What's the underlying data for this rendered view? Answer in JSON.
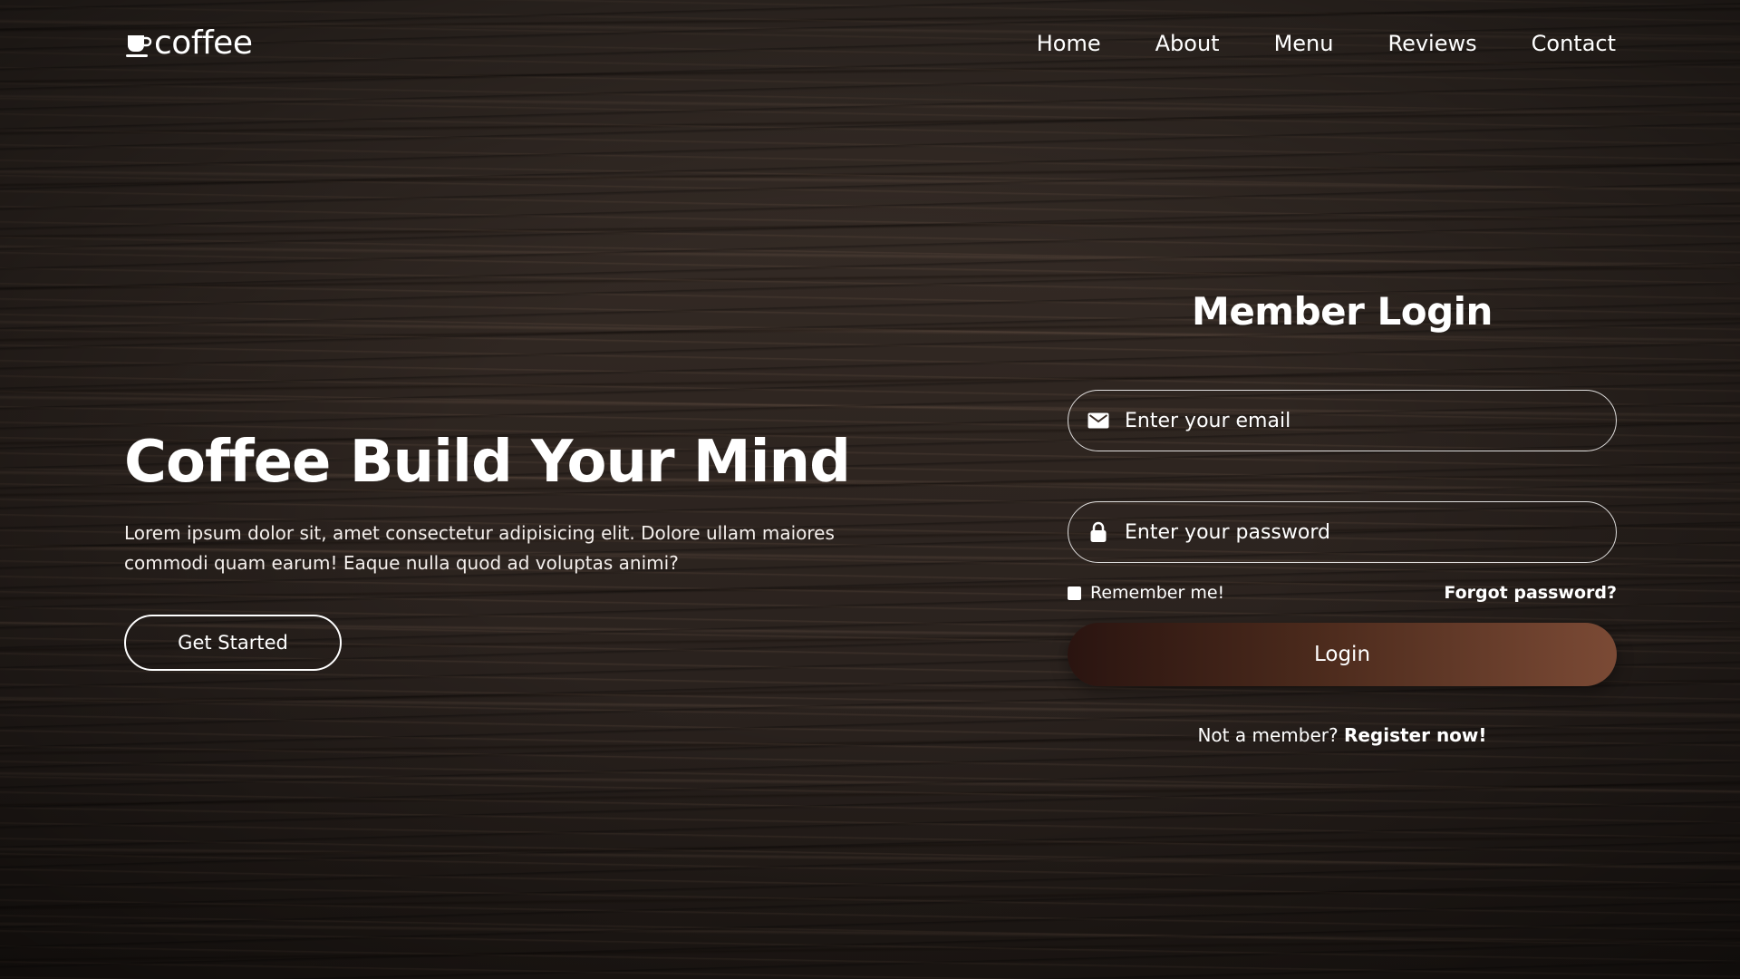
{
  "brand": {
    "name": "coffee",
    "icon": "coffee-cup-icon"
  },
  "nav": {
    "items": [
      {
        "label": "Home"
      },
      {
        "label": "About"
      },
      {
        "label": "Menu"
      },
      {
        "label": "Reviews"
      },
      {
        "label": "Contact"
      }
    ]
  },
  "hero": {
    "title": "Coffee Build Your Mind",
    "description": "Lorem ipsum dolor sit, amet consectetur adipisicing elit. Dolore ullam maiores commodi quam earum! Eaque nulla quod ad voluptas animi?",
    "cta_label": "Get Started"
  },
  "login": {
    "title": "Member Login",
    "email_placeholder": "Enter your email",
    "email_icon": "envelope-icon",
    "password_placeholder": "Enter your password",
    "password_icon": "lock-icon",
    "remember_label": "Remember me!",
    "forgot_label": "Forgot password?",
    "submit_label": "Login",
    "register_prompt": "Not a member?",
    "register_link": "Register now!"
  },
  "colors": {
    "text": "#ffffff",
    "button_gradient_start": "#2a1410",
    "button_gradient_end": "#7b4a35",
    "background_wood": "#2e2520"
  }
}
